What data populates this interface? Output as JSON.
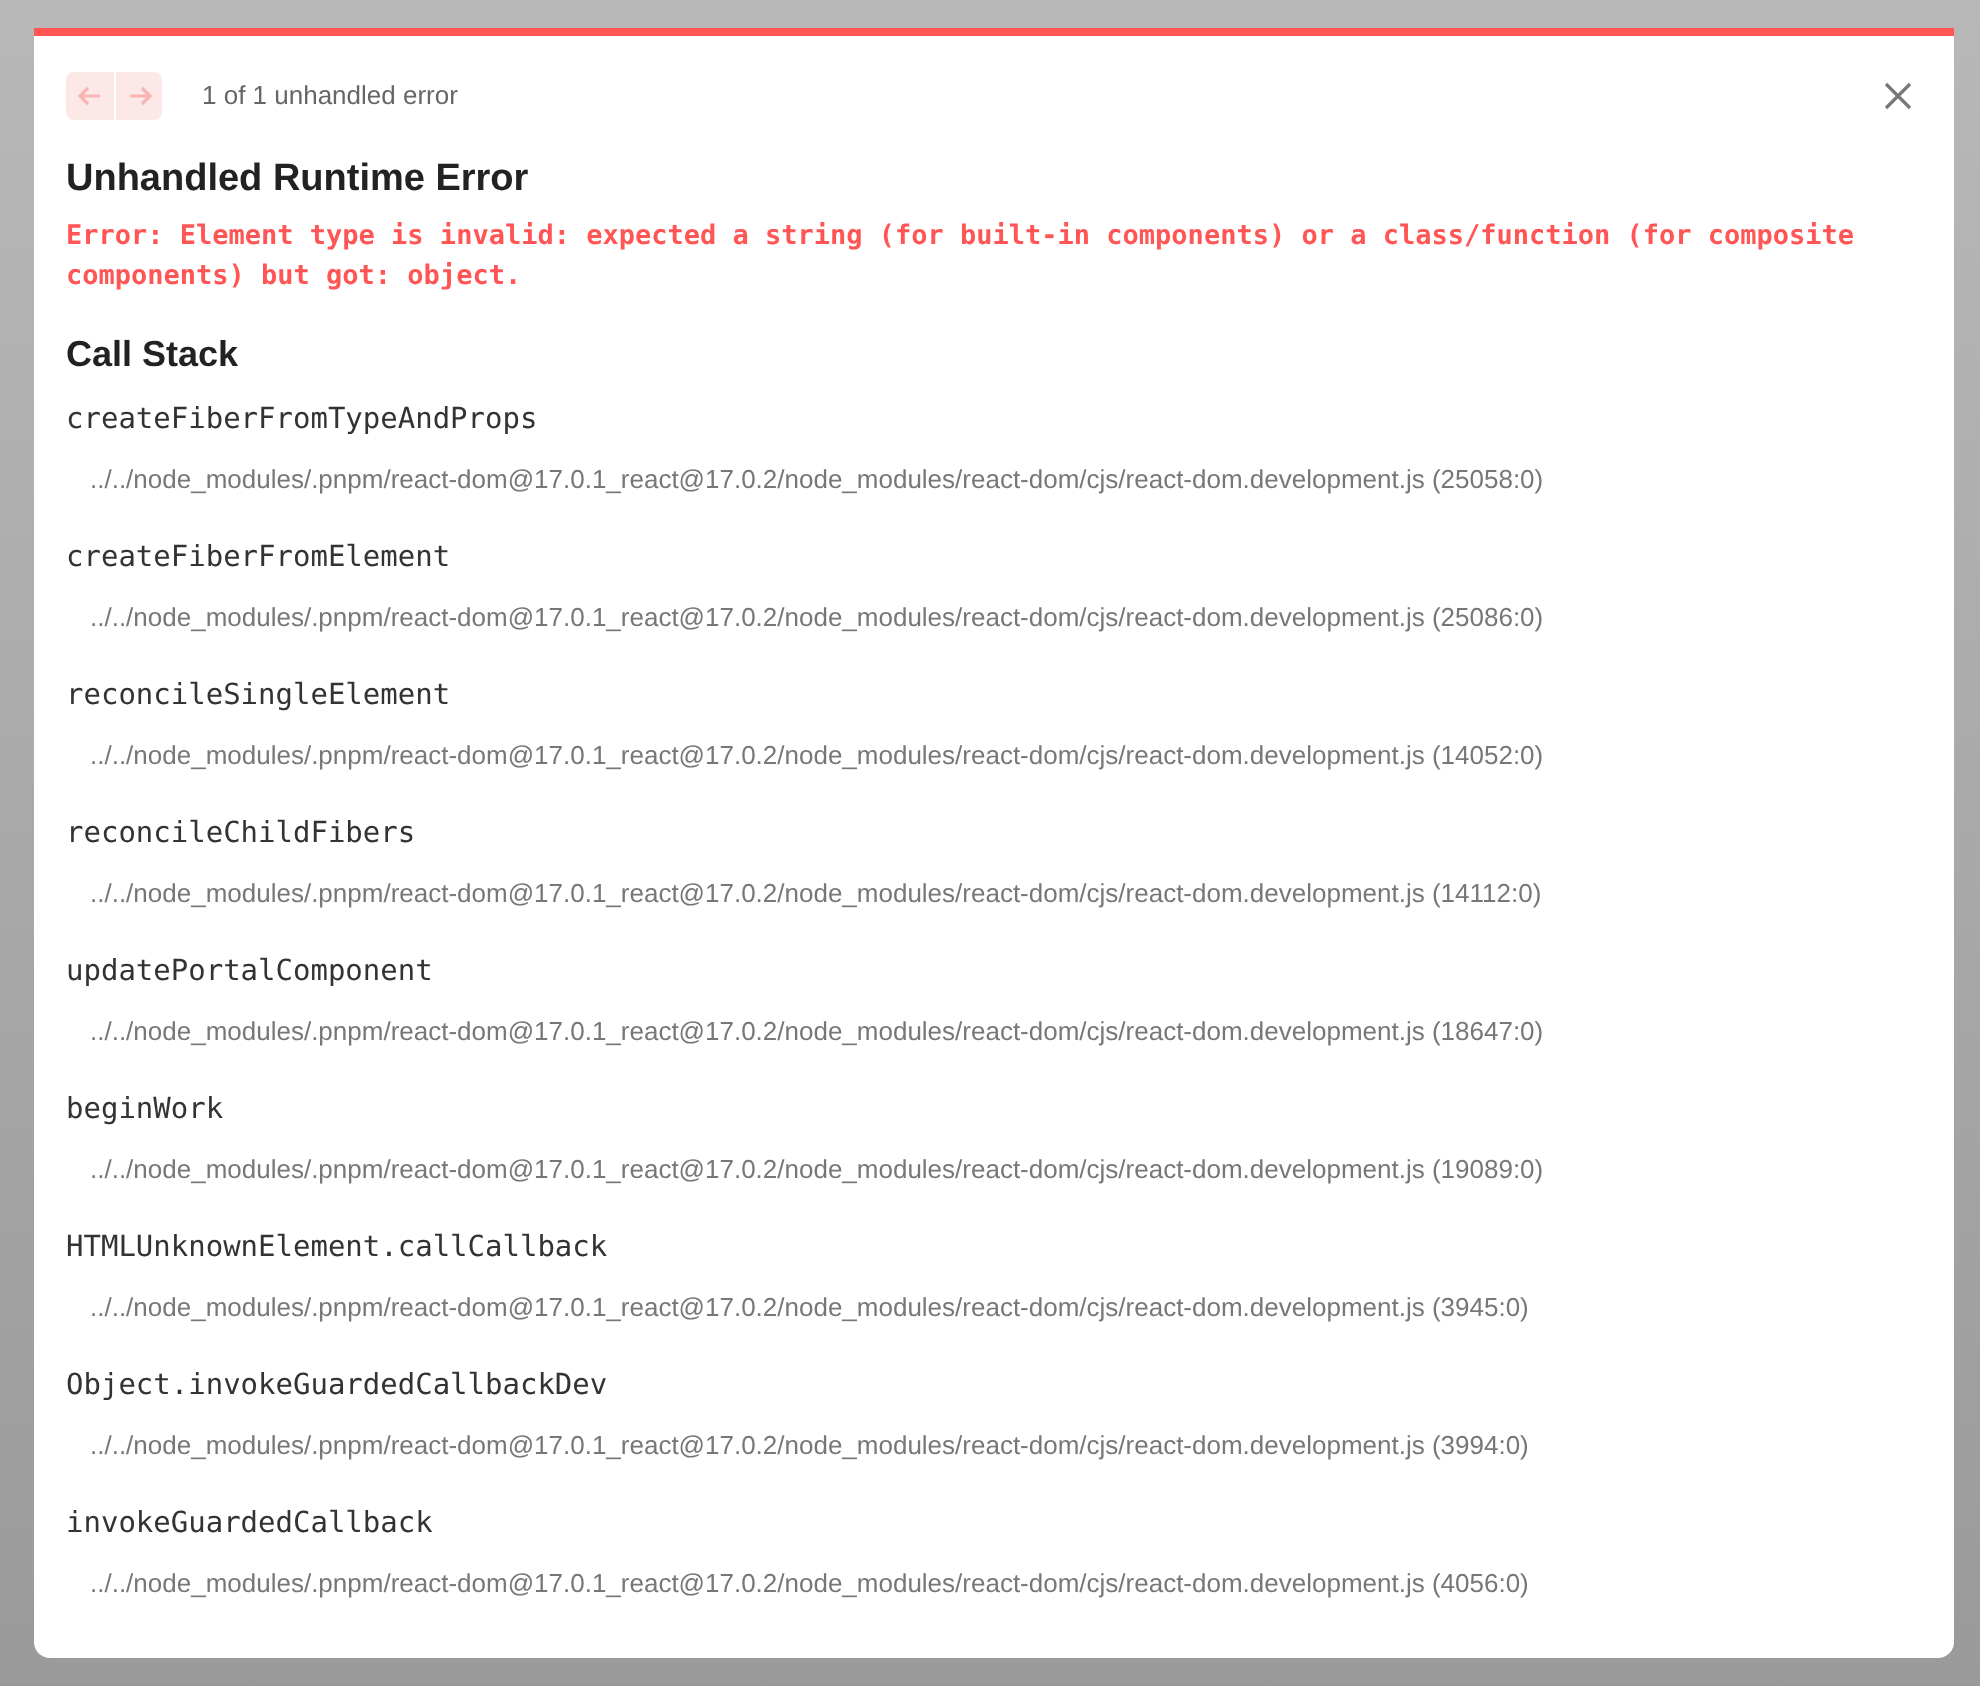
{
  "nav": {
    "prev": {
      "disabled": true
    },
    "next": {
      "disabled": true
    },
    "counter": "1 of 1 unhandled error"
  },
  "title": "Unhandled Runtime Error",
  "message": "Error: Element type is invalid: expected a string (for built-in components) or a class/function (for composite components) but got: object.",
  "call_stack": {
    "heading": "Call Stack",
    "frames": [
      {
        "function": "createFiberFromTypeAndProps",
        "location": "../../node_modules/.pnpm/react-dom@17.0.1_react@17.0.2/node_modules/react-dom/cjs/react-dom.development.js (25058:0)"
      },
      {
        "function": "createFiberFromElement",
        "location": "../../node_modules/.pnpm/react-dom@17.0.1_react@17.0.2/node_modules/react-dom/cjs/react-dom.development.js (25086:0)"
      },
      {
        "function": "reconcileSingleElement",
        "location": "../../node_modules/.pnpm/react-dom@17.0.1_react@17.0.2/node_modules/react-dom/cjs/react-dom.development.js (14052:0)"
      },
      {
        "function": "reconcileChildFibers",
        "location": "../../node_modules/.pnpm/react-dom@17.0.1_react@17.0.2/node_modules/react-dom/cjs/react-dom.development.js (14112:0)"
      },
      {
        "function": "updatePortalComponent",
        "location": "../../node_modules/.pnpm/react-dom@17.0.1_react@17.0.2/node_modules/react-dom/cjs/react-dom.development.js (18647:0)"
      },
      {
        "function": "beginWork",
        "location": "../../node_modules/.pnpm/react-dom@17.0.1_react@17.0.2/node_modules/react-dom/cjs/react-dom.development.js (19089:0)"
      },
      {
        "function": "HTMLUnknownElement.callCallback",
        "location": "../../node_modules/.pnpm/react-dom@17.0.1_react@17.0.2/node_modules/react-dom/cjs/react-dom.development.js (3945:0)"
      },
      {
        "function": "Object.invokeGuardedCallbackDev",
        "location": "../../node_modules/.pnpm/react-dom@17.0.1_react@17.0.2/node_modules/react-dom/cjs/react-dom.development.js (3994:0)"
      },
      {
        "function": "invokeGuardedCallback",
        "location": "../../node_modules/.pnpm/react-dom@17.0.1_react@17.0.2/node_modules/react-dom/cjs/react-dom.development.js (4056:0)"
      }
    ]
  }
}
